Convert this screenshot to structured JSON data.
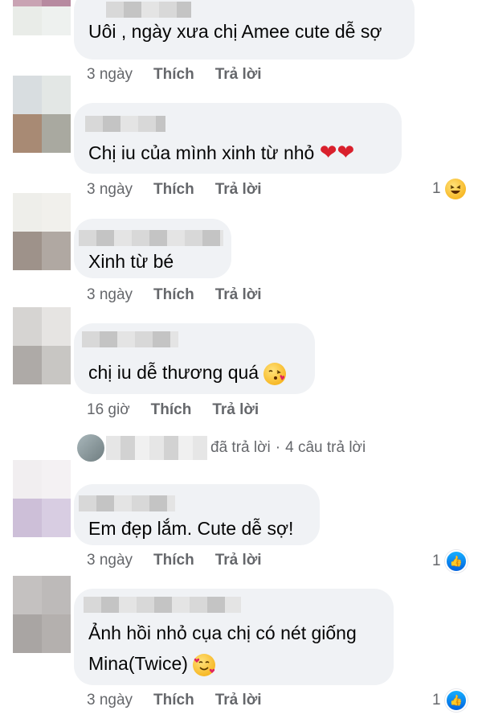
{
  "actions": {
    "like": "Thích",
    "reply": "Trả lời"
  },
  "comments": [
    {
      "text": "Uôi , ngày xưa chị Amee cute dễ sợ",
      "time": "3 ngày"
    },
    {
      "text": "Chị iu của mình xinh từ nhỏ",
      "time": "3 ngày",
      "reaction_count": "1",
      "reaction_icon": "laughing-emoji-icon"
    },
    {
      "text": "Xinh từ bé",
      "time": "3 ngày"
    },
    {
      "text": "chị iu dễ thương quá",
      "time": "16 giờ"
    },
    {
      "text": "Em đẹp lắm. Cute dễ sợ!",
      "time": "3 ngày",
      "reaction_count": "1",
      "reaction_icon": "like-icon"
    },
    {
      "text_line1": "Ảnh hồi nhỏ cụa chị có nét giống",
      "text_line2": "Mina(Twice)",
      "time": "3 ngày",
      "reaction_count": "1",
      "reaction_icon": "like-icon"
    }
  ],
  "reply_summary": {
    "label": "đã trả lời",
    "separator": "·",
    "count_text": "4 câu trả lời"
  },
  "colors": {
    "bubble": "#f0f2f5",
    "meta": "#65676b",
    "text": "#050505",
    "like_blue": "#1877f2",
    "heart_red": "#d9202c"
  }
}
